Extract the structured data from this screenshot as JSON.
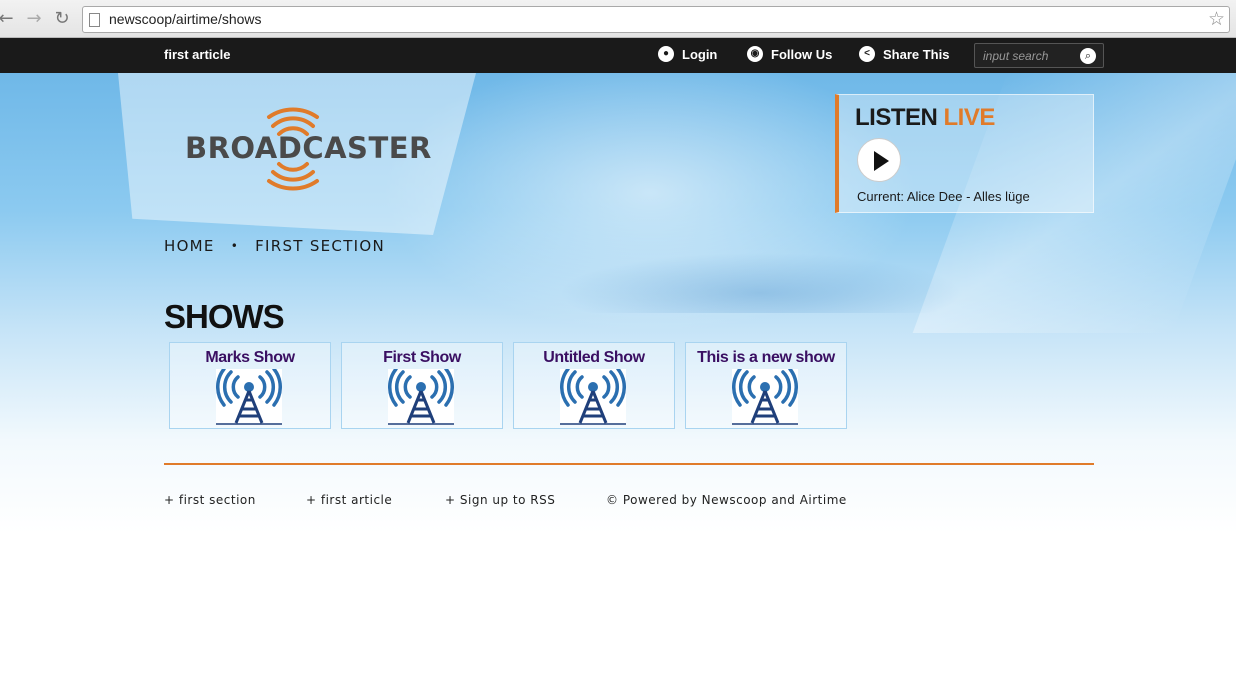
{
  "browser": {
    "url": "newscoop/airtime/shows"
  },
  "topbar": {
    "brand_link": "first article",
    "login": "Login",
    "follow": "Follow Us",
    "share": "Share This",
    "search_placeholder": "input search"
  },
  "logo": {
    "text_left": "BROADC",
    "text_right": "ASTER"
  },
  "nav": {
    "items": [
      "HOME",
      "FIRST SECTION"
    ]
  },
  "listen": {
    "title_main": "LISTEN ",
    "title_accent": "LIVE",
    "current": "Current: Alice Dee - Alles lüge"
  },
  "shows": {
    "title": "SHOWS",
    "items": [
      {
        "name": "Marks Show"
      },
      {
        "name": "First Show"
      },
      {
        "name": "Untitled Show"
      },
      {
        "name": "This is a new show"
      }
    ]
  },
  "footer": {
    "links": [
      "+ first section",
      "+ first article",
      "+ Sign up to RSS"
    ],
    "powered": "© Powered by Newscoop and Airtime"
  },
  "colors": {
    "accent": "#e07b2a",
    "show_title": "#3a0f62",
    "topbar": "#1a1a1a"
  }
}
